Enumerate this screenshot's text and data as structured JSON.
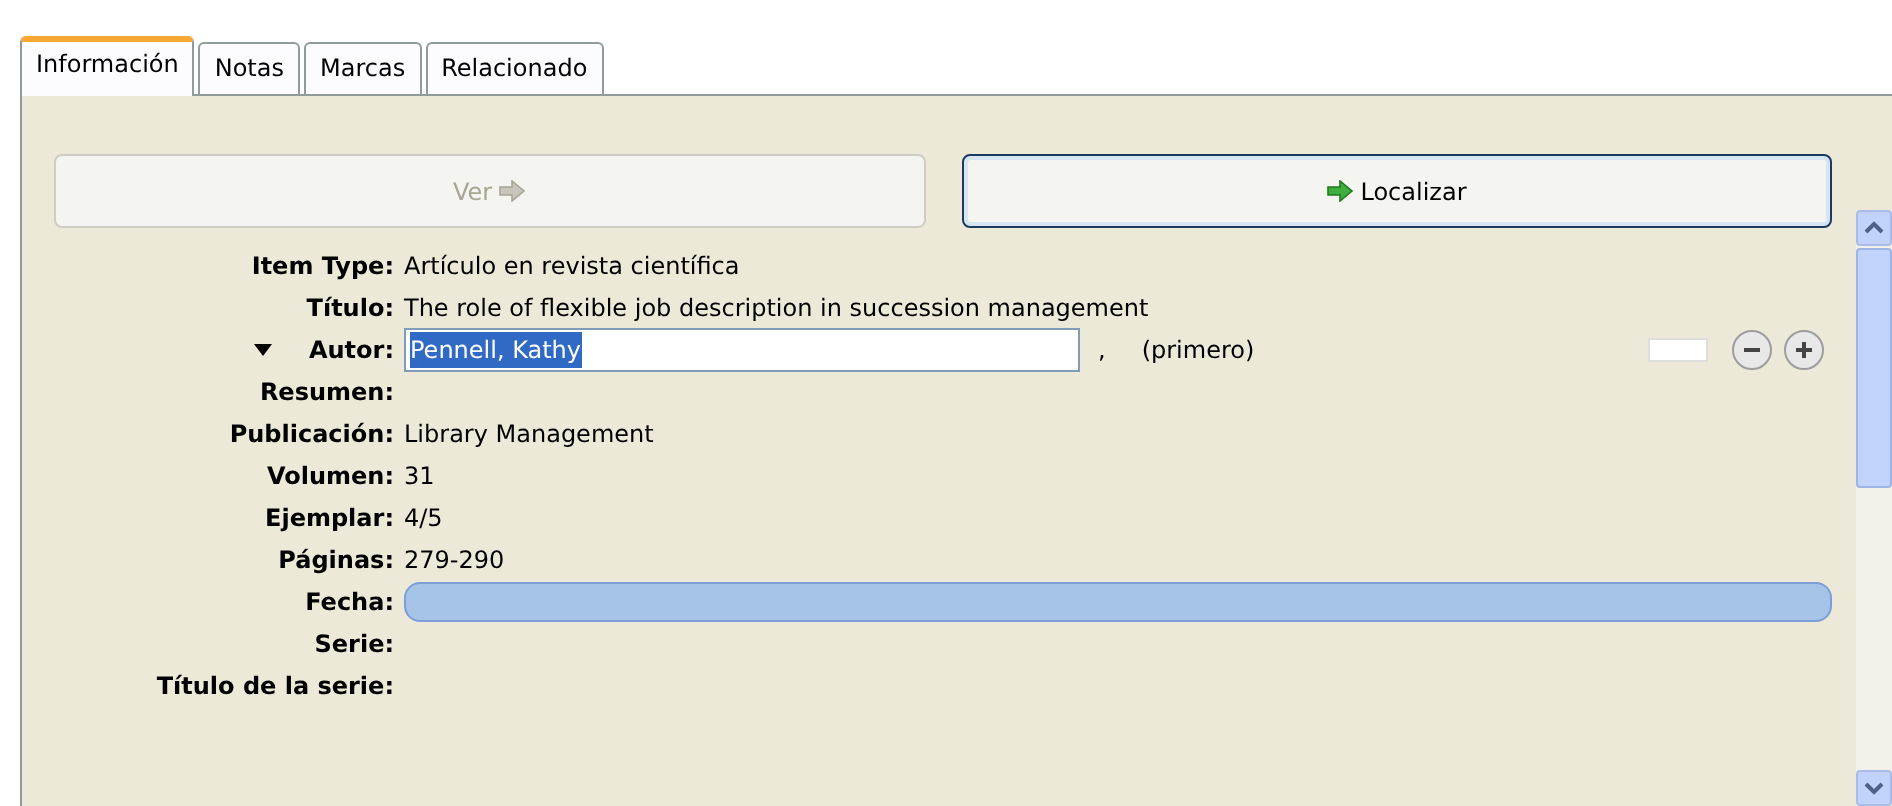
{
  "tabs": [
    {
      "label": "Información",
      "selected": true
    },
    {
      "label": "Notas",
      "selected": false
    },
    {
      "label": "Marcas",
      "selected": false
    },
    {
      "label": "Relacionado",
      "selected": false
    }
  ],
  "buttons": [
    {
      "label": "Ver",
      "disabled": true
    },
    {
      "label": "Localizar",
      "disabled": false
    }
  ],
  "fields": [
    {
      "kind": "text",
      "label": "Item Type:",
      "value": "Artículo en revista científica"
    },
    {
      "kind": "text",
      "label": "Título:",
      "value": "The role of flexible job description in succession management"
    },
    {
      "kind": "creator",
      "label": "Autor:",
      "value": "Pennell, Kathy",
      "expanded": true,
      "separator": ",",
      "note": "(primero)"
    },
    {
      "kind": "text",
      "label": "Resumen:"
    },
    {
      "kind": "text",
      "label": "Publicación:",
      "value": "Library Management"
    },
    {
      "kind": "text",
      "label": "Volumen:",
      "value": "31"
    },
    {
      "kind": "text",
      "label": "Ejemplar:",
      "value": "4/5"
    },
    {
      "kind": "text",
      "label": "Páginas:",
      "value": "279-290"
    },
    {
      "kind": "focused",
      "label": "Fecha:"
    },
    {
      "kind": "text",
      "label": "Serie:"
    },
    {
      "kind": "text",
      "label": "Título de la serie:"
    }
  ]
}
